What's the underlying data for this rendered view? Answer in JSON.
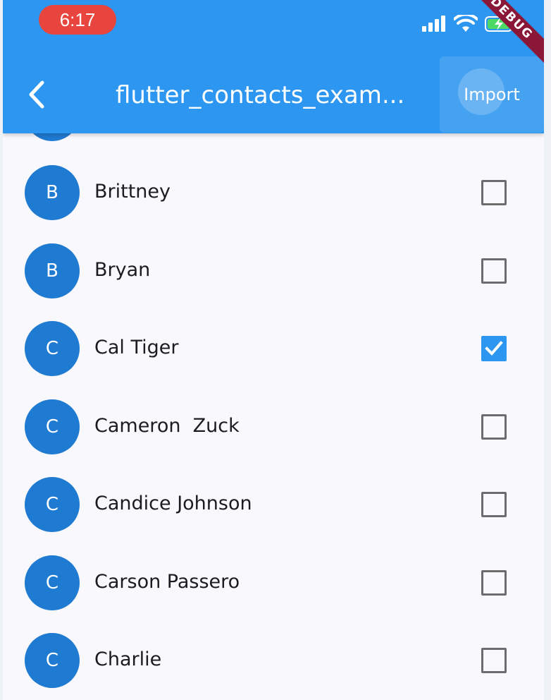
{
  "status_bar": {
    "time": "6:17",
    "signal_icon": "signal-bars-icon",
    "wifi_icon": "wifi-icon",
    "battery_icon": "battery-charging-icon"
  },
  "app_bar": {
    "back_icon": "back-chevron-icon",
    "title": "flutter_contacts_exam...",
    "action_label": "Import",
    "debug_banner": "DEBUG",
    "color": "#2c96f0"
  },
  "contacts": [
    {
      "initial": "B",
      "name": "Brittney",
      "checked": false
    },
    {
      "initial": "B",
      "name": "Bryan",
      "checked": false
    },
    {
      "initial": "C",
      "name": "Cal Tiger",
      "checked": true
    },
    {
      "initial": "C",
      "name": "Cameron  Zuck",
      "checked": false
    },
    {
      "initial": "C",
      "name": "Candice Johnson",
      "checked": false
    },
    {
      "initial": "C",
      "name": "Carson Passero",
      "checked": false
    },
    {
      "initial": "C",
      "name": "Charlie",
      "checked": false
    }
  ],
  "colors": {
    "avatar": "#1f7ad2",
    "checkbox_checked": "#2c96f0",
    "checkbox_border": "#6c6c6c"
  }
}
